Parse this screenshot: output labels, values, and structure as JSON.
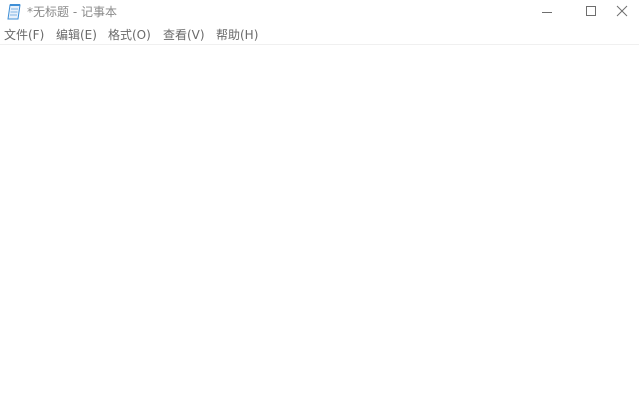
{
  "window": {
    "title": "*无标题 - 记事本",
    "icon": "notepad-icon",
    "controls": {
      "minimize_icon": "minimize-icon",
      "maximize_icon": "maximize-icon",
      "close_icon": "close-icon"
    }
  },
  "menubar": {
    "items": [
      {
        "label": "文件(F)"
      },
      {
        "label": "编辑(E)"
      },
      {
        "label": "格式(O)"
      },
      {
        "label": "查看(V)"
      },
      {
        "label": "帮助(H)"
      }
    ]
  },
  "editor": {
    "content": ""
  },
  "colors": {
    "text_muted": "#8a8a8a",
    "menu_text": "#6a6a6a",
    "background": "#ffffff",
    "icon_blue": "#3f8fd6"
  }
}
